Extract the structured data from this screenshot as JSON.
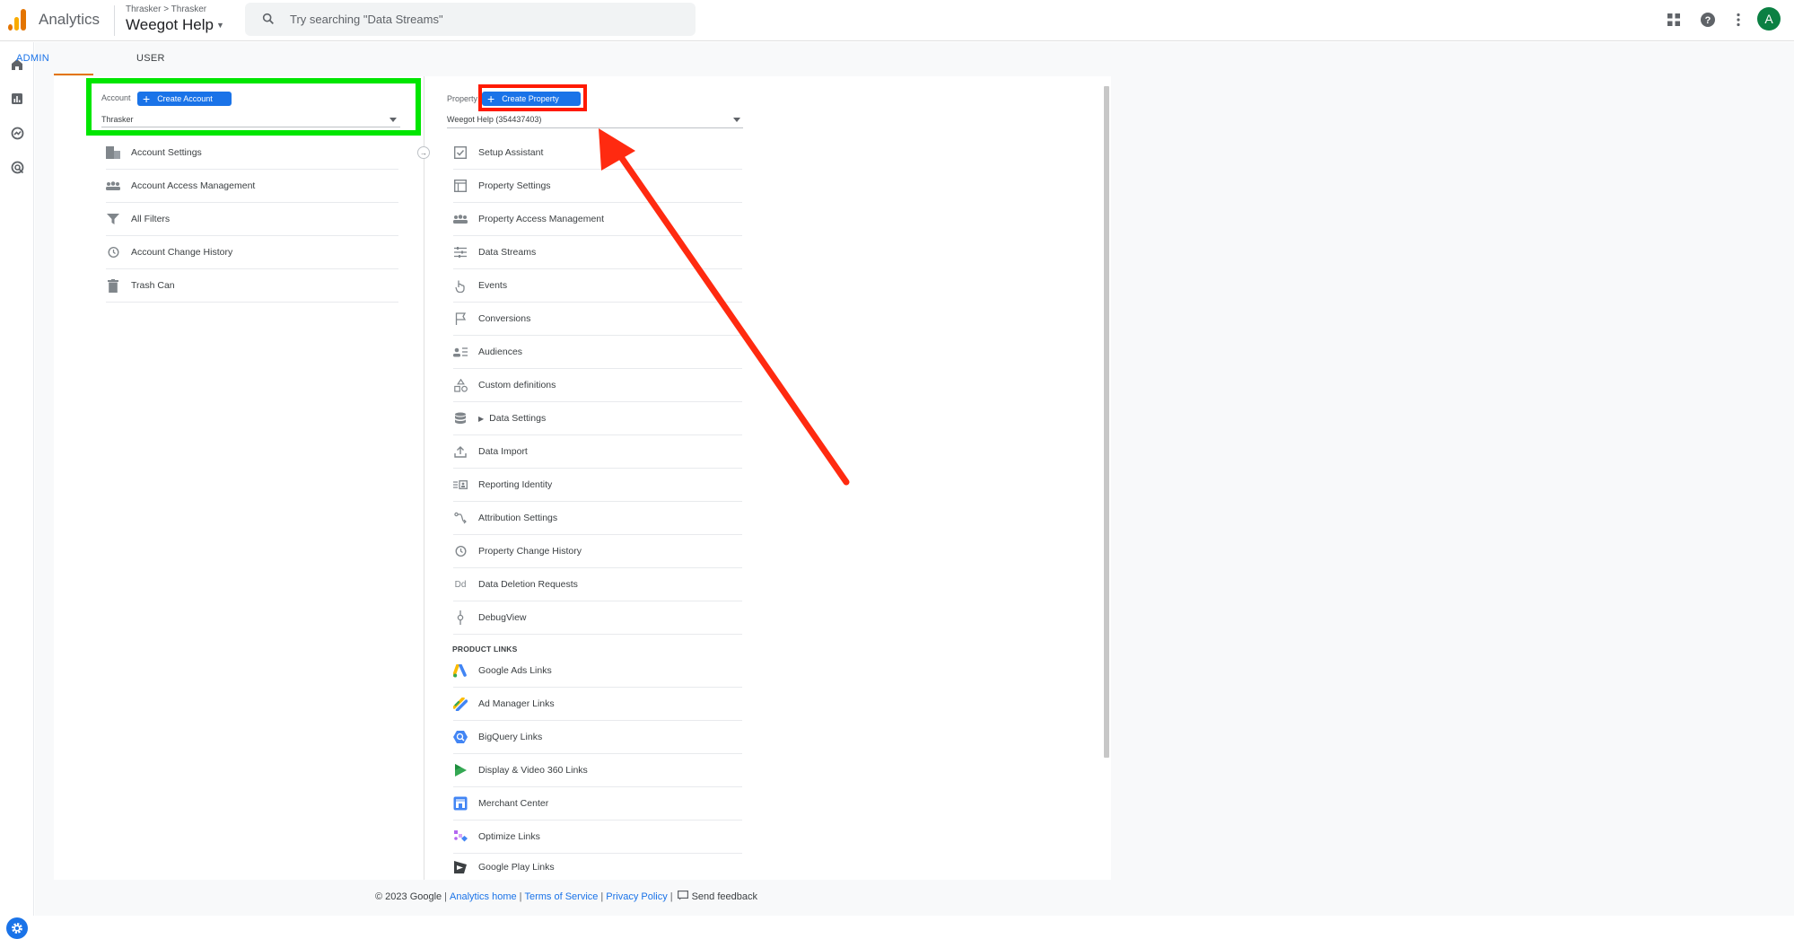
{
  "topbar": {
    "app_name": "Analytics",
    "breadcrumb": "Thrasker > Thrasker",
    "property_title": "Weegot Help",
    "search_placeholder": "Try searching \"Data Streams\"",
    "avatar_letter": "A"
  },
  "tabs": [
    {
      "label": "ADMIN",
      "active": true
    },
    {
      "label": "USER",
      "active": false
    }
  ],
  "account": {
    "label": "Account",
    "create_button": "Create Account",
    "selected": "Thrasker",
    "items": [
      {
        "label": "Account Settings",
        "icon": "building-icon"
      },
      {
        "label": "Account Access Management",
        "icon": "people-icon"
      },
      {
        "label": "All Filters",
        "icon": "filter-icon"
      },
      {
        "label": "Account Change History",
        "icon": "history-icon"
      },
      {
        "label": "Trash Can",
        "icon": "trash-icon"
      }
    ]
  },
  "property": {
    "label": "Property",
    "create_button": "Create Property",
    "selected": "Weegot Help (354437403)",
    "items": [
      {
        "label": "Setup Assistant",
        "icon": "checkbox-icon"
      },
      {
        "label": "Property Settings",
        "icon": "window-icon"
      },
      {
        "label": "Property Access Management",
        "icon": "people-icon"
      },
      {
        "label": "Data Streams",
        "icon": "streams-icon"
      },
      {
        "label": "Events",
        "icon": "touch-icon"
      },
      {
        "label": "Conversions",
        "icon": "flag-icon"
      },
      {
        "label": "Audiences",
        "icon": "audience-icon"
      },
      {
        "label": "Custom definitions",
        "icon": "shapes-icon"
      },
      {
        "label": "Data Settings",
        "icon": "database-icon"
      },
      {
        "label": "Data Import",
        "icon": "upload-icon"
      },
      {
        "label": "Reporting Identity",
        "icon": "identity-icon"
      },
      {
        "label": "Attribution Settings",
        "icon": "attribution-icon"
      },
      {
        "label": "Property Change History",
        "icon": "history-icon"
      },
      {
        "label": "Data Deletion Requests",
        "icon": "dd-icon"
      },
      {
        "label": "DebugView",
        "icon": "debug-icon"
      }
    ],
    "product_links_title": "PRODUCT LINKS",
    "product_links": [
      {
        "label": "Google Ads Links",
        "icon": "google-ads-icon"
      },
      {
        "label": "Ad Manager Links",
        "icon": "ad-manager-icon"
      },
      {
        "label": "BigQuery Links",
        "icon": "bigquery-icon"
      },
      {
        "label": "Display & Video 360 Links",
        "icon": "dv360-icon"
      },
      {
        "label": "Merchant Center",
        "icon": "merchant-center-icon"
      },
      {
        "label": "Optimize Links",
        "icon": "optimize-icon"
      },
      {
        "label": "Google Play Links",
        "icon": "google-play-icon"
      }
    ]
  },
  "footer": {
    "copyright": "© 2023 Google",
    "analytics_home": "Analytics home",
    "terms": "Terms of Service",
    "privacy": "Privacy Policy",
    "feedback": "Send feedback"
  },
  "colors": {
    "accent_blue": "#1a73e8",
    "highlight_green": "#00e600",
    "highlight_red": "#ff1a00",
    "arrow_red": "#ff2a10",
    "analytics_orange": "#e37400"
  }
}
